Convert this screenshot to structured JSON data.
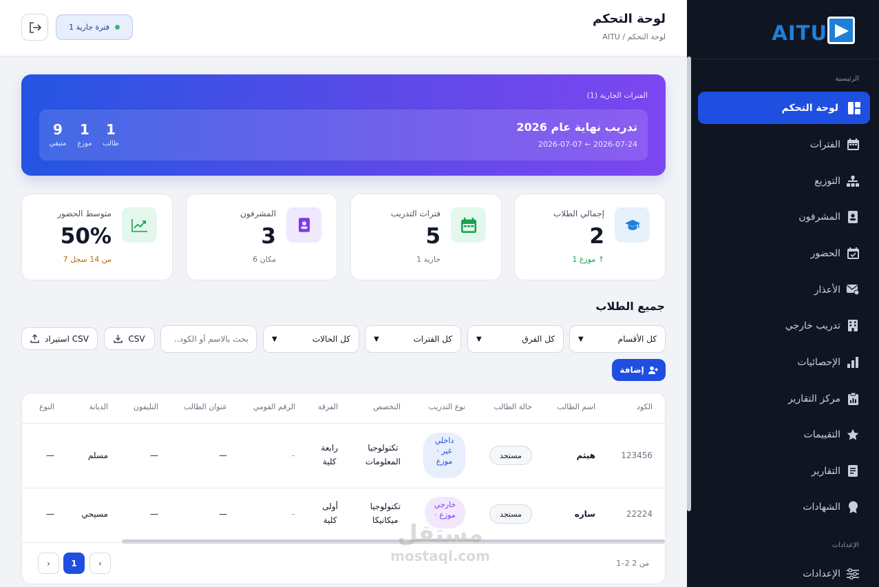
{
  "app": {
    "brand": "AITU"
  },
  "header": {
    "title": "لوحة التحكم",
    "breadcrumb": "AITU / لوحة التحكم",
    "active_periods_pill": "1 فترة جارية"
  },
  "sidebar": {
    "section_main": "الرئيسية",
    "section_settings": "الإعدادات",
    "items": [
      {
        "label": "لوحة التحكم",
        "icon": "dashboard-icon",
        "active": true
      },
      {
        "label": "الفترات",
        "icon": "calendar-icon"
      },
      {
        "label": "التوزيع",
        "icon": "sitemap-icon"
      },
      {
        "label": "المشرفون",
        "icon": "id-badge-icon"
      },
      {
        "label": "الحضور",
        "icon": "calendar-check-icon"
      },
      {
        "label": "الأعذار",
        "icon": "envelope-icon"
      },
      {
        "label": "تدريب خارجي",
        "icon": "building-icon"
      },
      {
        "label": "الإحصائيات",
        "icon": "bar-chart-icon"
      },
      {
        "label": "مركز التقارير",
        "icon": "report-icon"
      },
      {
        "label": "التقييمات",
        "icon": "star-icon"
      },
      {
        "label": "التقارير",
        "icon": "document-icon"
      },
      {
        "label": "الشهادات",
        "icon": "award-icon"
      },
      {
        "label": "الإعدادات",
        "icon": "sliders-icon"
      }
    ]
  },
  "hero": {
    "label": "الفترات الجارية (1)",
    "period_title": "تدريب نهاية عام 2026",
    "period_dates": "2026-07-07 ← 2026-07-24",
    "stats": [
      {
        "value": "1",
        "label": "طالب"
      },
      {
        "value": "1",
        "label": "موزع"
      },
      {
        "value": "9",
        "label": "متبقي"
      }
    ]
  },
  "cards": [
    {
      "label": "إجمالي الطلاب",
      "value": "2",
      "sub": "1 موزع",
      "arrow": "↑",
      "icon": "graduation-cap-icon",
      "color": "#1f80d8",
      "bg": "#e6f1fb",
      "sub_color": "#16a34a"
    },
    {
      "label": "فترات التدريب",
      "value": "5",
      "sub": "1 جارية",
      "icon": "calendar-icon",
      "color": "#16a34a",
      "bg": "#e4f7ec",
      "sub_color": "#6b7280"
    },
    {
      "label": "المشرفون",
      "value": "3",
      "sub": "6 مكان",
      "icon": "id-badge-icon",
      "color": "#7c3aed",
      "bg": "#efe9fd",
      "sub_color": "#6b7280"
    },
    {
      "label": "متوسط الحضور",
      "value": "50%",
      "sub": "7 من 14 سجل",
      "icon": "trend-up-icon",
      "color": "#16a34a",
      "bg": "#e4f7ec",
      "sub_color": "#c2650b"
    }
  ],
  "students": {
    "title": "جميع الطلاب",
    "filters": {
      "department": "كل الأقسام",
      "team": "كل الفرق",
      "period": "كل الفترات",
      "status": "كل الحالات"
    },
    "search_placeholder": "بحث بالاسم أو الكود..",
    "export_label": "CSV",
    "import_label": "استيراد CSV",
    "add_label": "إضافة",
    "columns": [
      "الكود",
      "اسم الطالب",
      "حالة الطالب",
      "نوع التدريب",
      "التخصص",
      "الفرقة",
      "الرقم القومي",
      "عنوان الطالب",
      "التليفون",
      "الديانة",
      "النوع"
    ],
    "rows": [
      {
        "code": "123456",
        "name": "هيثم",
        "status": "مستجد",
        "type_l1": "داخلي",
        "type_l2": "· غير",
        "type_l3": "موزع",
        "major_l1": "تكنولوجيا",
        "major_l2": "المعلومات",
        "team_l1": "رابعة",
        "team_l2": "كلية",
        "national_id": "–",
        "address": "—",
        "phone": "—",
        "religion": "مسلم",
        "gender": "—"
      },
      {
        "code": "22224",
        "name": "ساره",
        "status": "مستجد",
        "type_l1": "خارجي",
        "type_l2": "· موزع",
        "major_l1": "تكنولوجيا",
        "major_l2": "ميكانيكا",
        "team_l1": "أولى",
        "team_l2": "كلية",
        "national_id": "–",
        "address": "—",
        "phone": "—",
        "religion": "مسيحي",
        "gender": "—"
      }
    ],
    "pagination": {
      "info": "1–2 من 2",
      "current": "1",
      "prev": "‹",
      "next": "›"
    }
  },
  "watermark": {
    "line1": "مستقل",
    "line2": "mostaql.com"
  }
}
